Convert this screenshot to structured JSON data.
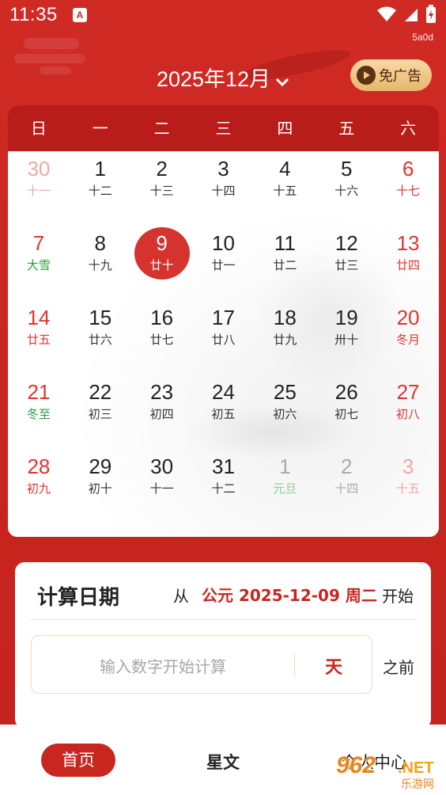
{
  "status_bar": {
    "time": "11:35",
    "app_badge": "A",
    "net_speed": "5a0d"
  },
  "header": {
    "month_title": "2025年12月",
    "ad_free_label": "免广告"
  },
  "calendar": {
    "weekdays": [
      "日",
      "一",
      "二",
      "三",
      "四",
      "五",
      "六"
    ],
    "weeks": [
      [
        {
          "d": "30",
          "l": "十一",
          "s": "faded"
        },
        {
          "d": "1",
          "l": "十二"
        },
        {
          "d": "2",
          "l": "十三"
        },
        {
          "d": "3",
          "l": "十四"
        },
        {
          "d": "4",
          "l": "十五"
        },
        {
          "d": "5",
          "l": "十六"
        },
        {
          "d": "6",
          "l": "十七",
          "s": "red"
        }
      ],
      [
        {
          "d": "7",
          "l": "大雪",
          "s": "red green"
        },
        {
          "d": "8",
          "l": "十九"
        },
        {
          "d": "9",
          "l": "廿十",
          "s": "today"
        },
        {
          "d": "10",
          "l": "廿一"
        },
        {
          "d": "11",
          "l": "廿二"
        },
        {
          "d": "12",
          "l": "廿三"
        },
        {
          "d": "13",
          "l": "廿四",
          "s": "red"
        }
      ],
      [
        {
          "d": "14",
          "l": "廿五",
          "s": "red"
        },
        {
          "d": "15",
          "l": "廿六"
        },
        {
          "d": "16",
          "l": "廿七"
        },
        {
          "d": "17",
          "l": "廿八"
        },
        {
          "d": "18",
          "l": "廿九"
        },
        {
          "d": "19",
          "l": "卅十"
        },
        {
          "d": "20",
          "l": "冬月",
          "s": "red"
        }
      ],
      [
        {
          "d": "21",
          "l": "冬至",
          "s": "red green"
        },
        {
          "d": "22",
          "l": "初三"
        },
        {
          "d": "23",
          "l": "初四"
        },
        {
          "d": "24",
          "l": "初五"
        },
        {
          "d": "25",
          "l": "初六"
        },
        {
          "d": "26",
          "l": "初七"
        },
        {
          "d": "27",
          "l": "初八",
          "s": "red"
        }
      ],
      [
        {
          "d": "28",
          "l": "初九",
          "s": "red"
        },
        {
          "d": "29",
          "l": "初十"
        },
        {
          "d": "30",
          "l": "十一"
        },
        {
          "d": "31",
          "l": "十二"
        },
        {
          "d": "1",
          "l": "元旦",
          "s": "fadedgreen"
        },
        {
          "d": "2",
          "l": "十四",
          "s": "fadedgray"
        },
        {
          "d": "3",
          "l": "十五",
          "s": "faded"
        }
      ]
    ]
  },
  "calc": {
    "title": "计算日期",
    "from_label": "从",
    "date_text": "公元 2025-12-09 周二",
    "start_label": "开始",
    "input_placeholder": "输入数字开始计算",
    "unit_label": "天",
    "before_label": "之前"
  },
  "bottom_nav": {
    "home": "首页",
    "star": "星文",
    "me": "个人中心"
  },
  "watermark": {
    "big": "962",
    "net": ".NET",
    "cn": "乐游网"
  },
  "colors": {
    "primary_red": "#c8261f",
    "header_red": "#b81d19",
    "holiday_red": "#e0352f",
    "solar_term_green": "#2a9d3b",
    "gold": "#e9b56b"
  }
}
